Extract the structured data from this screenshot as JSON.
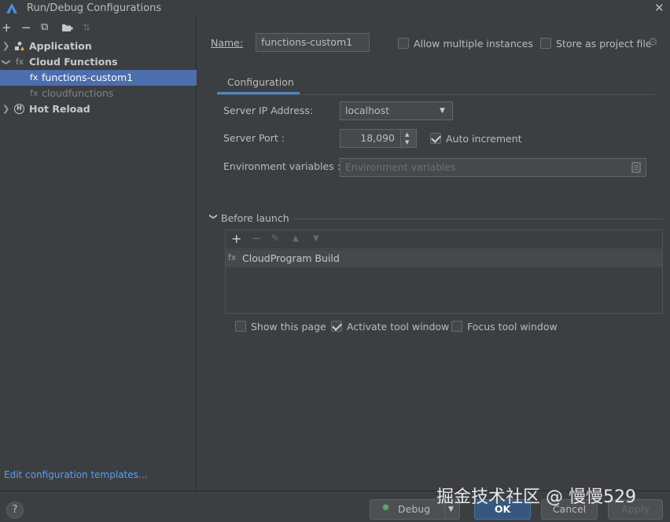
{
  "window": {
    "title": "Run/Debug Configurations"
  },
  "toolbar": {
    "add": "+",
    "remove": "−",
    "copy": "⧉",
    "folder": "▆",
    "sort": "⇅"
  },
  "tree": {
    "items": [
      {
        "label": "Application",
        "icon": "fx"
      },
      {
        "label": "Cloud Functions",
        "icon": "fx"
      },
      {
        "label": "functions-custom1",
        "icon": "fx"
      },
      {
        "label": "cloudfunctions",
        "icon": "fx"
      },
      {
        "label": "Hot Reload",
        "icon": "H"
      }
    ]
  },
  "edit_templates": "Edit configuration templates...",
  "form": {
    "name_label": "Name:",
    "name_value": "functions-custom1",
    "allow_multiple": "Allow multiple instances",
    "store_project": "Store as project file",
    "tab": "Configuration",
    "server_ip_label": "Server IP Address:",
    "server_ip_value": "localhost",
    "server_port_label": "Server Port :",
    "server_port_value": "18,090",
    "auto_increment": "Auto increment",
    "env_label": "Environment variables :",
    "env_placeholder": "Environment variables"
  },
  "before_launch": {
    "title": "Before launch",
    "item": "CloudProgram Build",
    "item_icon": "fx",
    "show_page": "Show this page",
    "activate_tool": "Activate tool window",
    "focus_tool": "Focus tool window"
  },
  "buttons": {
    "help": "?",
    "debug": "Debug",
    "ok": "OK",
    "cancel": "Cancel",
    "apply": "Apply"
  },
  "watermark": "掘金技术社区 @ 慢慢529",
  "colors": {
    "selection": "#4b6eaf",
    "link": "#589df6",
    "tab_underline": "#4a88c7",
    "ok": "#365880"
  }
}
